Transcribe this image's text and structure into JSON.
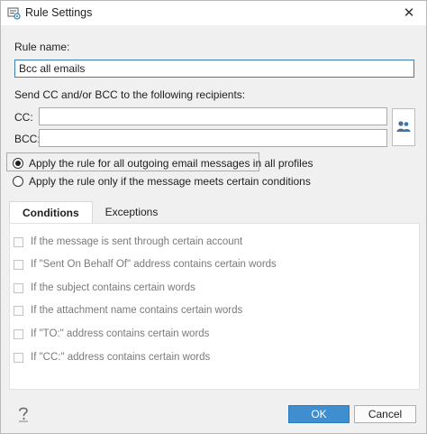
{
  "window": {
    "title": "Rule Settings",
    "title_icon": "rule-settings-icon",
    "close_glyph": "✕"
  },
  "rule_name": {
    "label": "Rule name:",
    "value": "Bcc all emails"
  },
  "recipients": {
    "heading": "Send CC and/or BCC to the following recipients:",
    "cc_label": "CC:",
    "cc_value": "",
    "bcc_label": "BCC:",
    "bcc_value": "",
    "address_book_icon": "people-icon"
  },
  "apply_options": [
    {
      "label": "Apply the rule for all outgoing email messages in all profiles",
      "checked": true
    },
    {
      "label": "Apply the rule only if the message meets certain conditions",
      "checked": false
    }
  ],
  "tabs": [
    {
      "label": "Conditions",
      "active": true
    },
    {
      "label": "Exceptions",
      "active": false
    }
  ],
  "conditions": [
    {
      "label": "If the message is sent through certain account",
      "checked": false
    },
    {
      "label": "If \"Sent On Behalf Of\" address contains certain words",
      "checked": false
    },
    {
      "label": "If the subject contains certain words",
      "checked": false
    },
    {
      "label": "If the attachment name contains certain words",
      "checked": false
    },
    {
      "label": "If \"TO:\" address contains certain words",
      "checked": false
    },
    {
      "label": "If \"CC:\" address contains certain words",
      "checked": false
    }
  ],
  "footer": {
    "help_icon": "help-icon",
    "ok_label": "OK",
    "cancel_label": "Cancel"
  },
  "colors": {
    "ok_button": "#3e8ed0",
    "highlight": "#e87ee8",
    "disabled_text": "#7a7a7a"
  }
}
